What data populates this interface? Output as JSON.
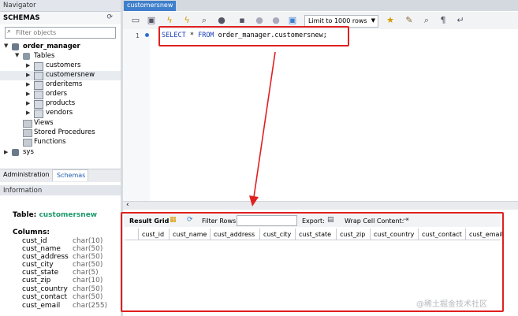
{
  "navigator": {
    "title": "Navigator",
    "schemas_label": "SCHEMAS",
    "filter_placeholder": "Filter objects",
    "tree": {
      "database": "order_manager",
      "tables_label": "Tables",
      "tables": [
        "customers",
        "customersnew",
        "orderitems",
        "orders",
        "products",
        "vendors"
      ],
      "views_label": "Views",
      "procedures_label": "Stored Procedures",
      "functions_label": "Functions",
      "other_db": "sys"
    },
    "bottom_tabs": [
      "Administration",
      "Schemas"
    ]
  },
  "information": {
    "header": "Information",
    "table_prefix": "Table:",
    "table_name": "customersnew",
    "columns_label": "Columns:",
    "columns": [
      {
        "name": "cust_id",
        "type": "char(10)"
      },
      {
        "name": "cust_name",
        "type": "char(50)"
      },
      {
        "name": "cust_address",
        "type": "char(50)"
      },
      {
        "name": "cust_city",
        "type": "char(50)"
      },
      {
        "name": "cust_state",
        "type": "char(5)"
      },
      {
        "name": "cust_zip",
        "type": "char(10)"
      },
      {
        "name": "cust_country",
        "type": "char(50)"
      },
      {
        "name": "cust_contact",
        "type": "char(50)"
      },
      {
        "name": "cust_email",
        "type": "char(255)"
      }
    ]
  },
  "editor": {
    "tab_title": "customersnew",
    "limit_label": "Limit to 1000 rows",
    "line_number": "1",
    "sql_keyword_select": "SELECT",
    "sql_star": " * ",
    "sql_keyword_from": "FROM",
    "sql_rest": " order_manager.customersnew;"
  },
  "results": {
    "result_grid_label": "Result Grid",
    "filter_rows_label": "Filter Rows:",
    "export_label": "Export:",
    "wrap_label": "Wrap Cell Content:",
    "columns": [
      "cust_id",
      "cust_name",
      "cust_address",
      "cust_city",
      "cust_state",
      "cust_zip",
      "cust_country",
      "cust_contact",
      "cust_email"
    ]
  },
  "watermark": "@稀土掘金技术社区",
  "colors": {
    "accent": "#3f7fcb",
    "highlight": "#e02020",
    "table_name": "#1d9a6c"
  }
}
